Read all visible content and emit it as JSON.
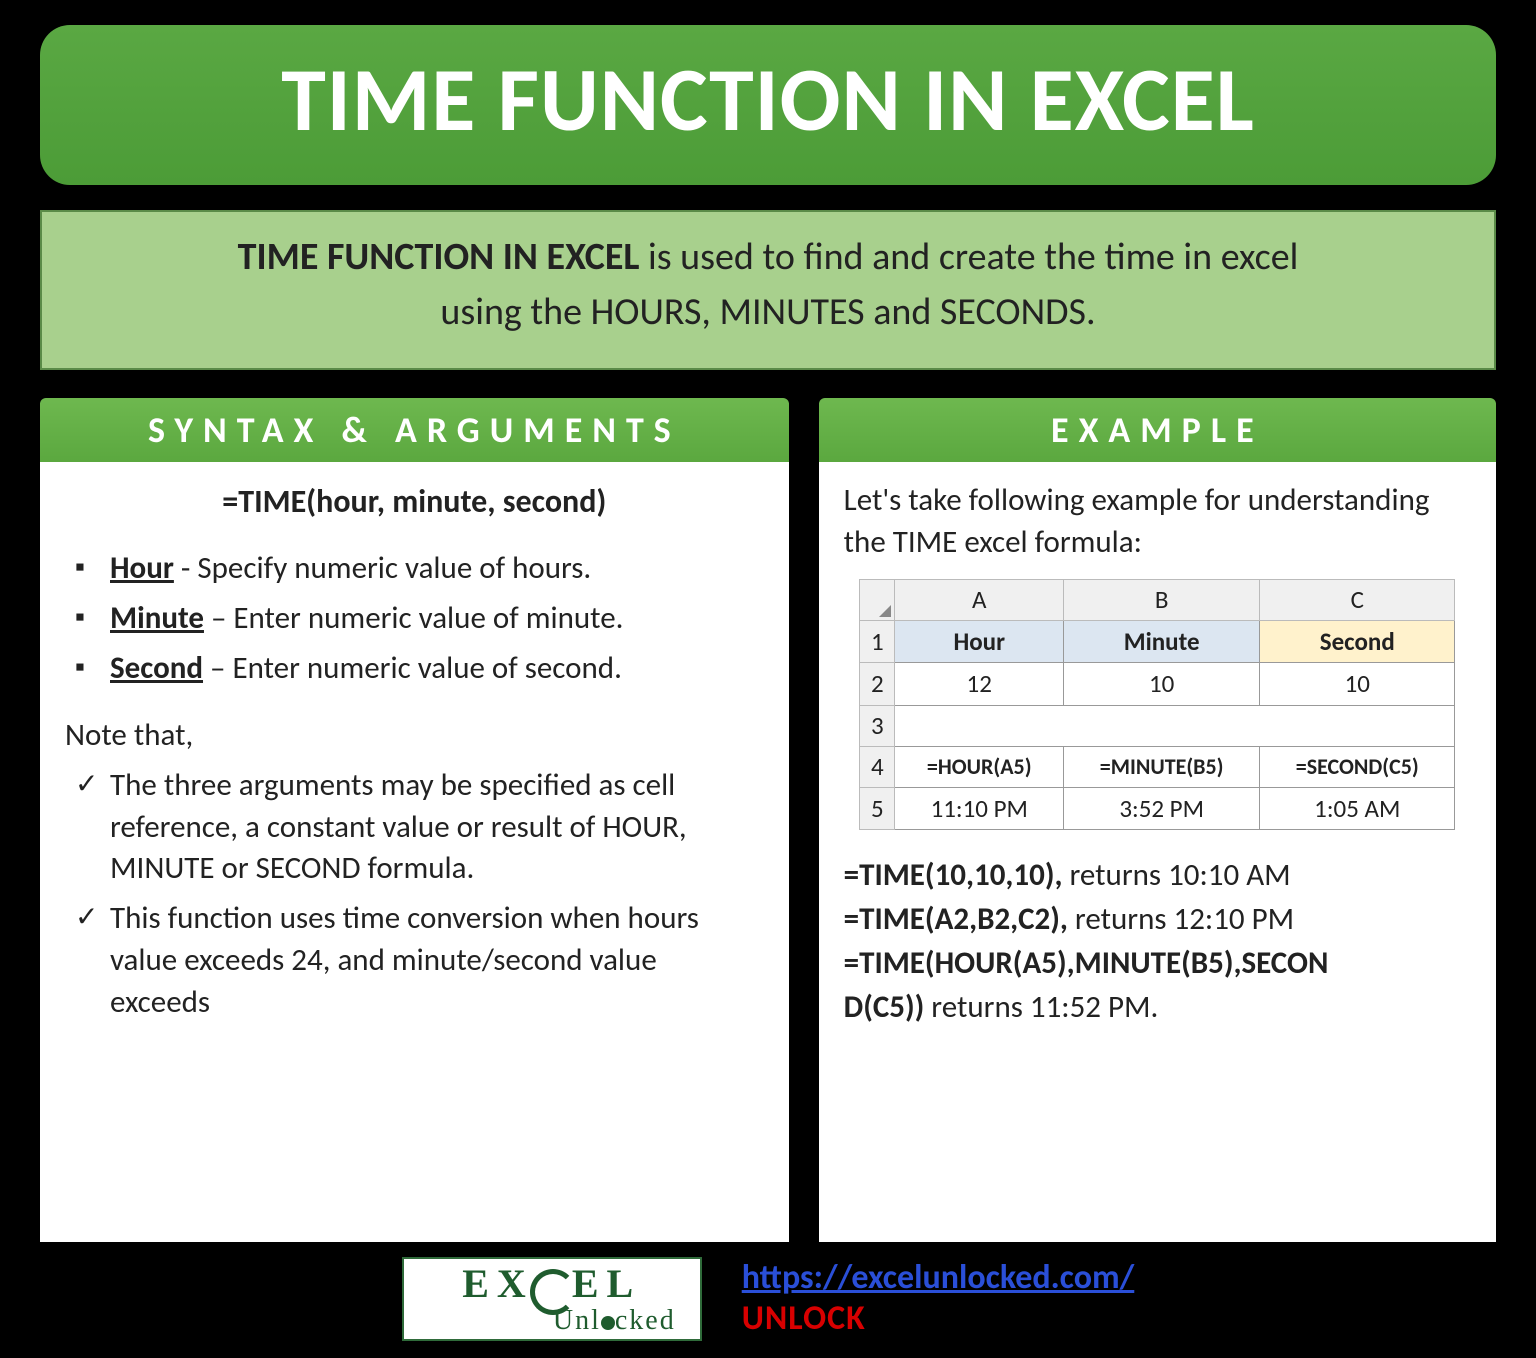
{
  "title": "TIME FUNCTION IN EXCEL",
  "description": {
    "bold": "TIME FUNCTION IN EXCEL",
    "rest1": " is used to find and create the time in excel",
    "line2": "using the HOURS, MINUTES and SECONDS."
  },
  "syntax": {
    "header": "SYNTAX & ARGUMENTS",
    "formula": "=TIME(hour, minute, second)",
    "args": [
      {
        "name": "Hour",
        "desc": " - Specify numeric value of hours."
      },
      {
        "name": "Minute",
        "desc": " – Enter numeric value of minute."
      },
      {
        "name": "Second",
        "desc": " – Enter numeric value of second."
      }
    ],
    "note_label": "Note that,",
    "notes": [
      "The three arguments may be specified as cell reference, a constant value or result of HOUR, MINUTE or SECOND formula.",
      "This function uses time conversion when hours value exceeds 24, and minute/second value exceeds"
    ]
  },
  "example": {
    "header": "EXAMPLE",
    "intro": "Let's take following example for understanding the TIME excel formula:",
    "grid": {
      "cols": [
        "A",
        "B",
        "C"
      ],
      "rows": [
        "1",
        "2",
        "3",
        "4",
        "5"
      ],
      "r1": {
        "a": "Hour",
        "b": "Minute",
        "c": "Second"
      },
      "r2": {
        "a": "12",
        "b": "10",
        "c": "10"
      },
      "r4": {
        "a": "=HOUR(A5)",
        "b": "=MINUTE(B5)",
        "c": "=SECOND(C5)"
      },
      "r5": {
        "a": "11:10 PM",
        "b": "3:52 PM",
        "c": "1:05 AM"
      }
    },
    "lines": [
      {
        "bold": "=TIME(10,10,10),",
        "rest": " returns 10:10 AM"
      },
      {
        "bold": "=TIME(A2,B2,C2),",
        "rest": " returns 12:10 PM"
      },
      {
        "bold": "=TIME(HOUR(A5),MINUTE(B5),SECON",
        "rest": ""
      },
      {
        "bold": "D(C5))",
        "rest": " returns 11:52 PM."
      }
    ]
  },
  "footer": {
    "logo_top_pre": "EX",
    "logo_top_post": "EL",
    "logo_bottom_pre": "Unl",
    "logo_bottom_post": "cked",
    "url": "https://excelunlocked.com/",
    "unlock": "UNLOCK"
  }
}
